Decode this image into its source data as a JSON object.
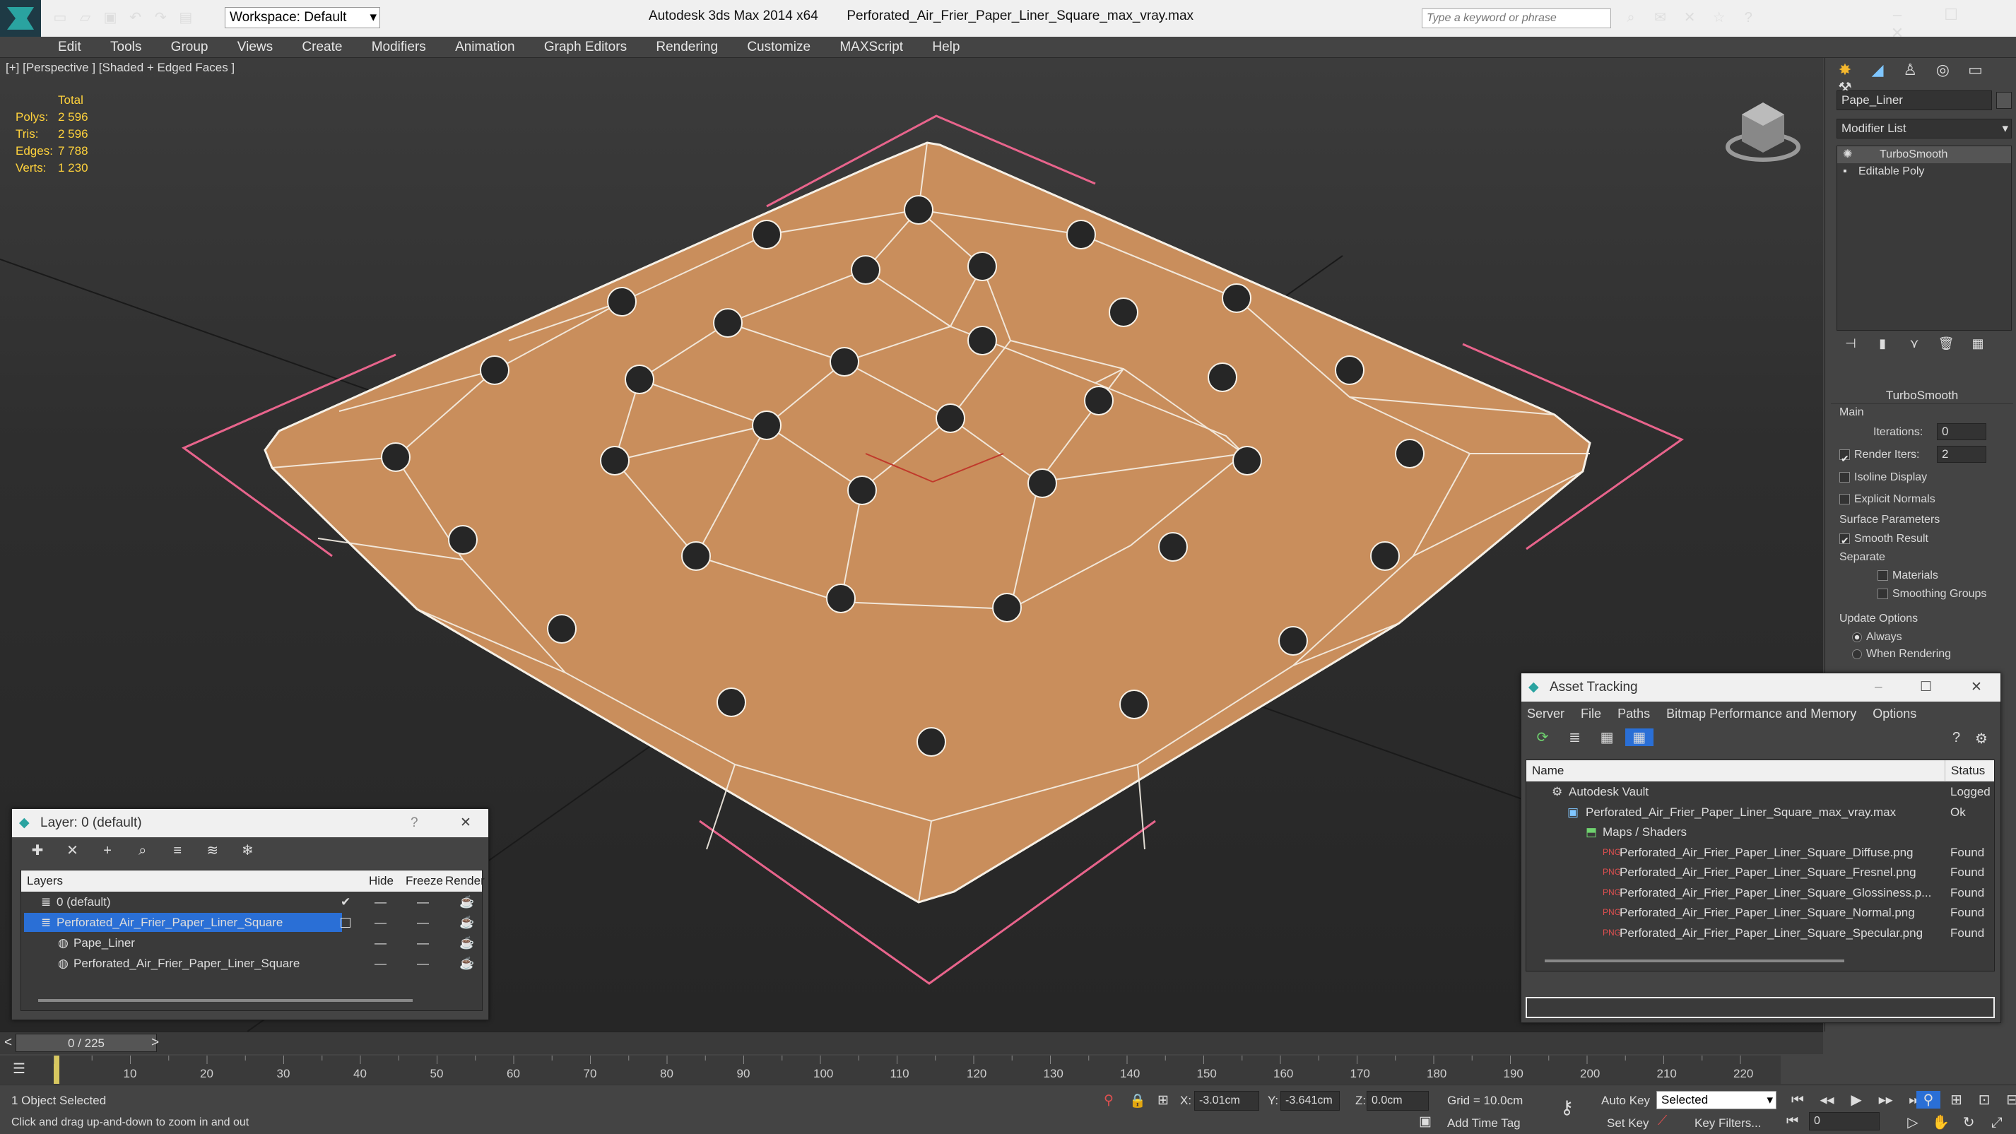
{
  "titlebar": {
    "app_title": "Autodesk 3ds Max  2014 x64",
    "file_name": "Perforated_Air_Frier_Paper_Liner_Square_max_vray.max",
    "workspace": "Workspace: Default",
    "search_placeholder": "Type a keyword or phrase"
  },
  "menu": [
    "Edit",
    "Tools",
    "Group",
    "Views",
    "Create",
    "Modifiers",
    "Animation",
    "Graph Editors",
    "Rendering",
    "Customize",
    "MAXScript",
    "Help"
  ],
  "viewport": {
    "label": "[+] [Perspective ] [Shaded + Edged Faces ]",
    "stats": {
      "header": "Total",
      "rows": [
        {
          "k": "Polys:",
          "v": "2 596"
        },
        {
          "k": "Tris:",
          "v": "2 596"
        },
        {
          "k": "Edges:",
          "v": "7 788"
        },
        {
          "k": "Verts:",
          "v": "1 230"
        }
      ]
    }
  },
  "command_panel": {
    "object_name": "Pape_Liner",
    "modifier_list": "Modifier List",
    "stack": [
      "TurboSmooth",
      "Editable Poly"
    ],
    "rollout_title": "TurboSmooth",
    "main_label": "Main",
    "iterations_label": "Iterations:",
    "iterations_value": "0",
    "render_iters_label": "Render Iters:",
    "render_iters_value": "2",
    "isoline": "Isoline Display",
    "explicit_normals": "Explicit Normals",
    "surface_params": "Surface Parameters",
    "smooth_result": "Smooth Result",
    "separate": "Separate",
    "materials": "Materials",
    "smoothing_groups": "Smoothing Groups",
    "update_options": "Update Options",
    "always": "Always",
    "when_rendering": "When Rendering"
  },
  "layer_panel": {
    "title": "Layer: 0 (default)",
    "help": "?",
    "columns": [
      "Layers",
      "Hide",
      "Freeze",
      "Render"
    ],
    "rows": [
      {
        "name": "0 (default)",
        "level": 1
      },
      {
        "name": "Perforated_Air_Frier_Paper_Liner_Square",
        "level": 1
      },
      {
        "name": "Pape_Liner",
        "level": 2
      },
      {
        "name": "Perforated_Air_Frier_Paper_Liner_Square",
        "level": 2
      }
    ]
  },
  "asset_panel": {
    "title": "Asset Tracking",
    "menu": [
      "Server",
      "File",
      "Paths",
      "Bitmap Performance and Memory",
      "Options"
    ],
    "columns": [
      "Name",
      "Status"
    ],
    "rows": [
      {
        "name": "Autodesk Vault",
        "status": "Logged Ou",
        "level": 1
      },
      {
        "name": "Perforated_Air_Frier_Paper_Liner_Square_max_vray.max",
        "status": "Ok",
        "level": 2
      },
      {
        "name": "Maps / Shaders",
        "status": "",
        "level": 3
      },
      {
        "name": "Perforated_Air_Frier_Paper_Liner_Square_Diffuse.png",
        "status": "Found",
        "level": 4
      },
      {
        "name": "Perforated_Air_Frier_Paper_Liner_Square_Fresnel.png",
        "status": "Found",
        "level": 4
      },
      {
        "name": "Perforated_Air_Frier_Paper_Liner_Square_Glossiness.p...",
        "status": "Found",
        "level": 4
      },
      {
        "name": "Perforated_Air_Frier_Paper_Liner_Square_Normal.png",
        "status": "Found",
        "level": 4
      },
      {
        "name": "Perforated_Air_Frier_Paper_Liner_Square_Specular.png",
        "status": "Found",
        "level": 4
      }
    ]
  },
  "timeline": {
    "frame": "0 / 225",
    "ticks": [
      "10",
      "20",
      "30",
      "40",
      "50",
      "60",
      "70",
      "80",
      "90",
      "100",
      "110",
      "120",
      "130",
      "140",
      "150",
      "160",
      "170",
      "180",
      "190",
      "200",
      "210",
      "220"
    ]
  },
  "status": {
    "selected": "1 Object Selected",
    "prompt": "Click and drag up-and-down to zoom in and out",
    "x_label": "X:",
    "x_value": "-3.01cm",
    "y_label": "Y:",
    "y_value": "-3.641cm",
    "z_label": "Z:",
    "z_value": "0.0cm",
    "grid": "Grid = 10.0cm",
    "add_time_tag": "Add Time Tag",
    "auto_key": "Auto Key",
    "set_key": "Set Key",
    "selected_dropdown": "Selected",
    "key_filters": "Key Filters...",
    "frame_field": "0"
  },
  "colors": {
    "liner": "#c98e5c",
    "accent": "#f0f0f0",
    "selection_blue": "#2a6fd6",
    "hole": "#262626",
    "bracket": "#e8648c"
  }
}
